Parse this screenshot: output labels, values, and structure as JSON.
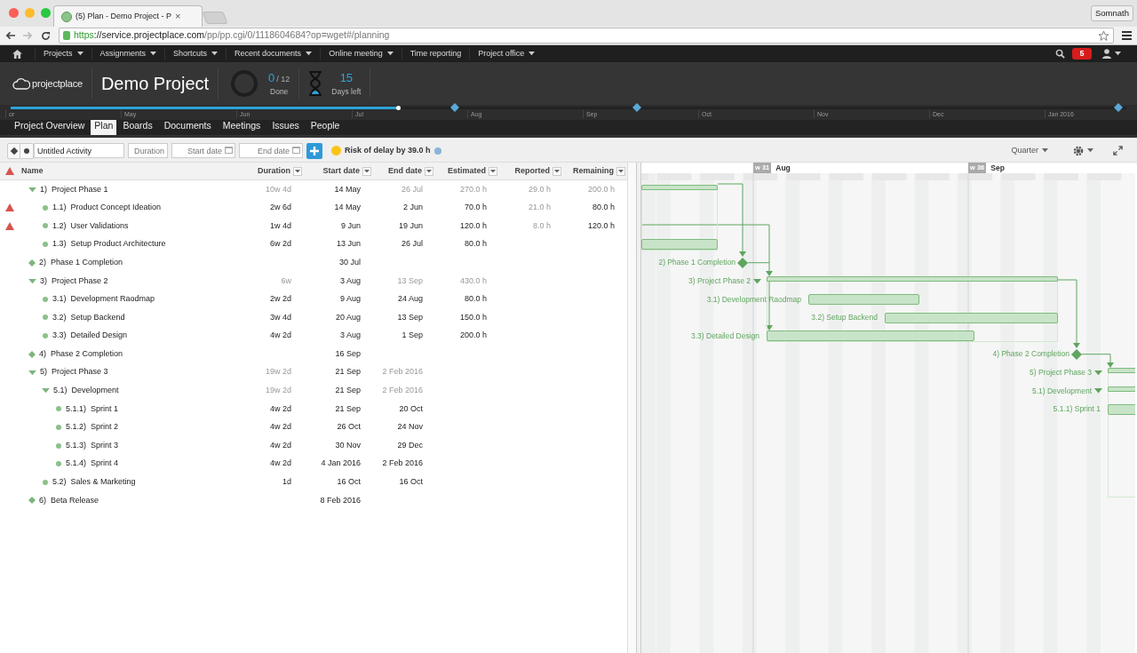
{
  "browser": {
    "tab_title": "(5) Plan - Demo Project - P",
    "tab_close": "×",
    "profile": "Somnath",
    "url_scheme": "https",
    "url_host": "://service.projectplace.com",
    "url_path": "/pp/pp.cgi/0/1118604684?op=wget#/planning"
  },
  "nav": {
    "items": [
      {
        "label": "Projects",
        "menu": true
      },
      {
        "label": "Assignments",
        "menu": true
      },
      {
        "label": "Shortcuts",
        "menu": true
      },
      {
        "label": "Recent documents",
        "menu": true
      },
      {
        "label": "Online meeting",
        "menu": true
      },
      {
        "label": "Time reporting",
        "menu": false
      },
      {
        "label": "Project office",
        "menu": true
      }
    ],
    "notifications": "5"
  },
  "header": {
    "logo": "projectplace",
    "project": "Demo Project",
    "done": "0",
    "total": "/ 12",
    "done_label": "Done",
    "days": "15",
    "days_label": "Days left"
  },
  "timeline": {
    "level": 0.347,
    "months": [
      "or",
      "May",
      "Jun",
      "Jul",
      "Aug",
      "Sep",
      "Oct",
      "Nov",
      "Dec",
      "Jan 2016"
    ]
  },
  "tabs": [
    {
      "label": "Project Overview",
      "selected": false
    },
    {
      "label": "Plan",
      "selected": true
    },
    {
      "label": "Boards",
      "selected": false
    },
    {
      "label": "Documents",
      "selected": false
    },
    {
      "label": "Meetings",
      "selected": false
    },
    {
      "label": "Issues",
      "selected": false
    },
    {
      "label": "People",
      "selected": false
    }
  ],
  "toolbar": {
    "activity": "Untitled Activity",
    "duration_placeholder": "Duration",
    "start_placeholder": "Start date",
    "end_placeholder": "End date",
    "risk": "Risk of delay by 39.0 h",
    "scale": "Quarter"
  },
  "table": {
    "columns": [
      "Name",
      "Duration",
      "Start date",
      "End date",
      "Estimated",
      "Reported",
      "Remaining"
    ],
    "rows": [
      {
        "kind": "summary",
        "expanded": true,
        "warning": false,
        "number": "1)",
        "name": "Project Phase 1",
        "duration": "10w 4d",
        "start": "14 May",
        "end": "26 Jul",
        "estimated": "270.0 h",
        "reported": "29.0 h",
        "remaining": "200.0 h",
        "children": [
          {
            "kind": "task",
            "warning": true,
            "number": "1.1)",
            "name": "Product Concept Ideation",
            "duration": "2w 6d",
            "start": "14 May",
            "end": "2 Jun",
            "estimated": "70.0 h",
            "reported": "21.0 h",
            "remaining": "80.0 h"
          },
          {
            "kind": "task",
            "warning": true,
            "number": "1.2)",
            "name": "User Validations",
            "duration": "1w 4d",
            "start": "9 Jun",
            "end": "19 Jun",
            "estimated": "120.0 h",
            "reported": "8.0 h",
            "remaining": "120.0 h"
          },
          {
            "kind": "task",
            "warning": false,
            "number": "1.3)",
            "name": "Setup Product Architecture",
            "duration": "6w 2d",
            "start": "13 Jun",
            "end": "26 Jul",
            "estimated": "80.0 h"
          }
        ]
      },
      {
        "kind": "milestone",
        "warning": false,
        "number": "2)",
        "name": "Phase 1 Completion",
        "start": "30 Jul"
      },
      {
        "kind": "summary",
        "expanded": true,
        "warning": false,
        "number": "3)",
        "name": "Project Phase 2",
        "duration": "6w",
        "start": "3 Aug",
        "end": "13 Sep",
        "estimated": "430.0 h",
        "children": [
          {
            "kind": "task",
            "warning": false,
            "number": "3.1)",
            "name": "Development Raodmap",
            "duration": "2w 2d",
            "start": "9 Aug",
            "end": "24 Aug",
            "estimated": "80.0 h"
          },
          {
            "kind": "task",
            "warning": false,
            "number": "3.2)",
            "name": "Setup Backend",
            "duration": "3w 4d",
            "start": "20 Aug",
            "end": "13 Sep",
            "estimated": "150.0 h"
          },
          {
            "kind": "task",
            "warning": false,
            "number": "3.3)",
            "name": "Detailed Design",
            "duration": "4w 2d",
            "start": "3 Aug",
            "end": "1 Sep",
            "estimated": "200.0 h"
          }
        ]
      },
      {
        "kind": "milestone",
        "warning": false,
        "number": "4)",
        "name": "Phase 2 Completion",
        "start": "16 Sep"
      },
      {
        "kind": "summary",
        "expanded": true,
        "warning": false,
        "number": "5)",
        "name": "Project Phase 3",
        "duration": "19w 2d",
        "start": "21 Sep",
        "end": "2 Feb 2016",
        "children": [
          {
            "kind": "summary",
            "expanded": true,
            "warning": false,
            "number": "5.1)",
            "name": "Development",
            "duration": "19w 2d",
            "start": "21 Sep",
            "end": "2 Feb 2016",
            "children": [
              {
                "kind": "task",
                "warning": false,
                "number": "5.1.1)",
                "name": "Sprint 1",
                "duration": "4w 2d",
                "start": "21 Sep",
                "end": "20 Oct"
              },
              {
                "kind": "task",
                "warning": false,
                "number": "5.1.2)",
                "name": "Sprint 2",
                "duration": "4w 2d",
                "start": "26 Oct",
                "end": "24 Nov"
              },
              {
                "kind": "task",
                "warning": false,
                "number": "5.1.3)",
                "name": "Sprint 3",
                "duration": "4w 2d",
                "start": "30 Nov",
                "end": "29 Dec"
              },
              {
                "kind": "task",
                "warning": false,
                "number": "5.1.4)",
                "name": "Sprint 4",
                "duration": "4w 2d",
                "start": "4 Jan 2016",
                "end": "2 Feb 2016"
              }
            ]
          },
          {
            "kind": "task",
            "warning": false,
            "number": "5.2)",
            "name": "Sales & Marketing",
            "duration": "1d",
            "start": "16 Oct",
            "end": "16 Oct"
          }
        ]
      },
      {
        "kind": "milestone",
        "warning": false,
        "number": "6)",
        "name": "Beta Release",
        "start": "8 Feb 2016"
      }
    ]
  },
  "gantt": {
    "weeks": [
      {
        "week": "w 31",
        "month": "Aug"
      },
      {
        "week": "w 36",
        "month": "Sep"
      }
    ],
    "items": [
      {
        "kind": "summary"
      },
      {
        "kind": "bar"
      },
      {
        "kind": "milestone",
        "label": "2) Phase 1 Completion"
      },
      {
        "kind": "summary",
        "label": "3) Project Phase 2"
      },
      {
        "kind": "bar",
        "label": "3.1) Development Raodmap"
      },
      {
        "kind": "bar",
        "label": "3.2) Setup Backend"
      },
      {
        "kind": "bar",
        "label": "3.3) Detailed Design"
      },
      {
        "kind": "milestone",
        "label": "4) Phase 2 Completion"
      },
      {
        "kind": "summary",
        "label": "5) Project Phase 3"
      },
      {
        "kind": "summary",
        "label": "5.1) Development"
      },
      {
        "kind": "bar",
        "label": "5.1.1) Sprint 1"
      }
    ]
  }
}
